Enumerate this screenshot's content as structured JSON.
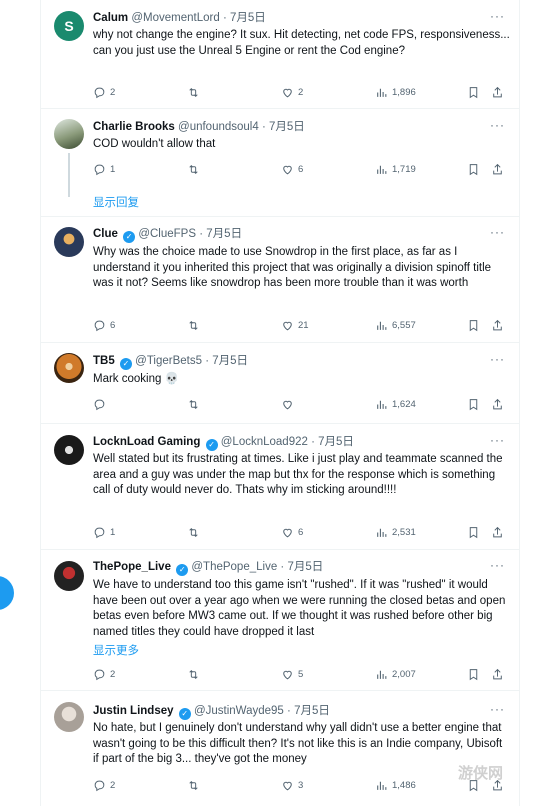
{
  "tweets": [
    {
      "name": "Calum",
      "handle": "@MovementLord",
      "date": "7月5日",
      "verified": false,
      "text": "why not change the engine? It sux. Hit detecting, net code FPS, responsiveness... can you just use the Unreal 5 Engine or rent the Cod engine?",
      "replies": "2",
      "retweets": "",
      "likes": "2",
      "views": "1,896",
      "avatar": {
        "type": "letter",
        "letter": "S",
        "color": "#1a8a6e"
      }
    },
    {
      "name": "Charlie Brooks",
      "handle": "@unfoundsoul4",
      "date": "7月5日",
      "verified": false,
      "text": "COD wouldn't allow that",
      "replies": "1",
      "retweets": "",
      "likes": "6",
      "views": "1,719",
      "show_link": "显示回复",
      "avatar": {
        "type": "image",
        "color": "#8a9a7a"
      }
    },
    {
      "name": "Clue",
      "handle": "@ClueFPS",
      "date": "7月5日",
      "verified": true,
      "text": "Why was the choice made to use Snowdrop in the first place, as far as I understand it you inherited this project that was originally a division spinoff title was it not? Seems like snowdrop has been more trouble than it was worth",
      "replies": "6",
      "retweets": "",
      "likes": "21",
      "views": "6,557",
      "avatar": {
        "type": "image",
        "color": "#2a3a5a"
      }
    },
    {
      "name": "TB5",
      "handle": "@TigerBets5",
      "date": "7月5日",
      "verified": true,
      "text": "Mark cooking 💀",
      "replies": "",
      "retweets": "",
      "likes": "",
      "views": "1,624",
      "avatar": {
        "type": "image",
        "color": "#b0662a"
      }
    },
    {
      "name": "LocknLoad Gaming",
      "handle": "@LocknLoad922",
      "date": "7月5日",
      "verified": true,
      "text": "Well stated but its frustrating at times. Like i just play and teammate scanned the area and  a guy was under the map but thx for the response which is something call of duty would never do. Thats why im sticking around!!!!",
      "replies": "1",
      "retweets": "",
      "likes": "6",
      "views": "2,531",
      "avatar": {
        "type": "image",
        "color": "#1a1a1a"
      }
    },
    {
      "name": "ThePope_Live",
      "handle": "@ThePope_Live",
      "date": "7月5日",
      "verified": true,
      "text": "We have to understand too this game isn't \"rushed\". If it was \"rushed\" it would have been out over a year ago when we were running the closed betas and open betas even before MW3 came out. If we thought it was rushed before other big named titles they could have dropped it last",
      "show_link": "显示更多",
      "replies": "2",
      "retweets": "",
      "likes": "5",
      "views": "2,007",
      "avatar": {
        "type": "image",
        "color": "#6a1a1a"
      }
    },
    {
      "name": "Justin Lindsey",
      "handle": "@JustinWayde95",
      "date": "7月5日",
      "verified": true,
      "text": "No hate, but I genuinely don't understand why yall didn't use a better engine that wasn't going to be this difficult then? It's not like this is an Indie company, Ubisoft if part of the big 3... they've got the money",
      "replies": "2",
      "retweets": "",
      "likes": "3",
      "views": "1,486",
      "avatar": {
        "type": "image",
        "color": "#c8c0b8"
      }
    }
  ],
  "watermark": "游侠网"
}
